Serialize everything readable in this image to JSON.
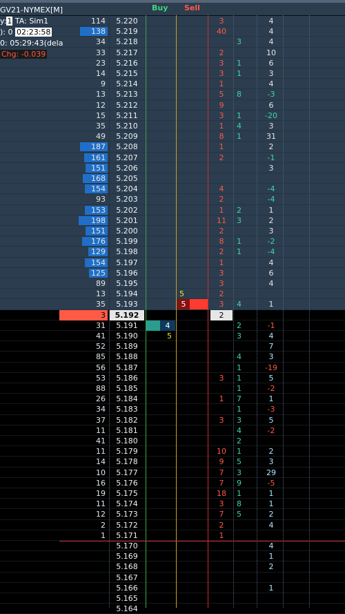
{
  "header": {
    "buy": "Buy",
    "sell": "Sell"
  },
  "instrument": {
    "symbol": "GV21-NYMEX[M]",
    "qty_label": "y:",
    "qty": "1",
    "ta": "TA: Sim1",
    "pos": "0",
    "pos_prefix": "):",
    "timer": "02:23:58",
    "clock": "0: 05:29:43(dela",
    "chg": "Chg: -0.039"
  },
  "colors": {
    "ask_bg": "#2b3d4f",
    "bid_bg": "#000000",
    "bar": "#1f6fc8",
    "buy_line": "#3aa845",
    "sell_line": "#d4a020",
    "red_line": "#c83030",
    "text_red": "#ff5a45",
    "text_green": "#3fd6a9",
    "text_yellow": "#f5e03a"
  },
  "rows": [
    {
      "p": "5.220",
      "v": "114",
      "b": 0,
      "c1": "3",
      "c2": "",
      "c3": "4"
    },
    {
      "p": "5.219",
      "v": "138",
      "b": 1.0,
      "c1": "40",
      "c2": "",
      "c3": "4"
    },
    {
      "p": "5.218",
      "v": "34",
      "b": 0,
      "c1": "",
      "c2": "3",
      "c3": "4"
    },
    {
      "p": "5.217",
      "v": "33",
      "b": 0,
      "c1": "2",
      "c2": "",
      "c3": "10"
    },
    {
      "p": "5.216",
      "v": "23",
      "b": 0,
      "c1": "3",
      "c2": "1",
      "c3": "6"
    },
    {
      "p": "5.215",
      "v": "14",
      "b": 0,
      "c1": "3",
      "c2": "1",
      "c3": "3"
    },
    {
      "p": "5.214",
      "v": "9",
      "b": 0,
      "c1": "1",
      "c2": "",
      "c3": "4"
    },
    {
      "p": "5.213",
      "v": "13",
      "b": 0,
      "c1": "5",
      "c2": "8",
      "c3": "-3"
    },
    {
      "p": "5.212",
      "v": "12",
      "b": 0,
      "c1": "9",
      "c2": "",
      "c3": "6"
    },
    {
      "p": "5.211",
      "v": "15",
      "b": 0,
      "c1": "3",
      "c2": "1",
      "c3": "-20"
    },
    {
      "p": "5.210",
      "v": "35",
      "b": 0,
      "c1": "1",
      "c2": "4",
      "c3": "3"
    },
    {
      "p": "5.209",
      "v": "49",
      "b": 0,
      "c1": "8",
      "c2": "1",
      "c3": "31"
    },
    {
      "p": "5.208",
      "v": "187",
      "b": 1.0,
      "c1": "1",
      "c2": "",
      "c3": "2"
    },
    {
      "p": "5.207",
      "v": "161",
      "b": 0.85,
      "c1": "2",
      "c2": "",
      "c3": "-1"
    },
    {
      "p": "5.206",
      "v": "151",
      "b": 0.8,
      "c1": "",
      "c2": "",
      "c3": "3"
    },
    {
      "p": "5.205",
      "v": "168",
      "b": 0.9,
      "c1": "",
      "c2": "",
      "c3": ""
    },
    {
      "p": "5.204",
      "v": "154",
      "b": 0.82,
      "c1": "4",
      "c2": "",
      "c3": "-4"
    },
    {
      "p": "5.203",
      "v": "93",
      "b": 0,
      "c1": "2",
      "c2": "",
      "c3": "-4"
    },
    {
      "p": "5.202",
      "v": "153",
      "b": 0.82,
      "c1": "1",
      "c2": "2",
      "c3": "1"
    },
    {
      "p": "5.201",
      "v": "198",
      "b": 1.05,
      "c1": "11",
      "c2": "3",
      "c3": "2"
    },
    {
      "p": "5.200",
      "v": "151",
      "b": 0.8,
      "c1": "2",
      "c2": "",
      "c3": "3"
    },
    {
      "p": "5.199",
      "v": "176",
      "b": 0.93,
      "c1": "8",
      "c2": "1",
      "c3": "-2"
    },
    {
      "p": "5.198",
      "v": "129",
      "b": 0.7,
      "c1": "2",
      "c2": "1",
      "c3": "-4"
    },
    {
      "p": "5.197",
      "v": "154",
      "b": 0.82,
      "c1": "1",
      "c2": "",
      "c3": "4"
    },
    {
      "p": "5.196",
      "v": "125",
      "b": 0.67,
      "c1": "3",
      "c2": "",
      "c3": "6"
    },
    {
      "p": "5.195",
      "v": "89",
      "b": 0,
      "c1": "3",
      "c2": "",
      "c3": "4"
    },
    {
      "p": "5.194",
      "v": "13",
      "b": 0,
      "c1": "2",
      "c2": "",
      "c3": "",
      "sellq": "5"
    },
    {
      "p": "5.193",
      "v": "35",
      "b": 0,
      "c1": "3",
      "c2": "4",
      "c3": "1",
      "sellbox": "5"
    },
    {
      "p": "5.192",
      "v": "3",
      "b": 0,
      "c1": "2",
      "c2": "",
      "c3": "",
      "last": true
    },
    {
      "p": "5.191",
      "v": "31",
      "b": 0,
      "c1": "",
      "c2": "2",
      "c3": "-1",
      "buybox": "4"
    },
    {
      "p": "5.190",
      "v": "41",
      "b": 0,
      "c1": "",
      "c2": "3",
      "c3": "4",
      "buyq": "5"
    },
    {
      "p": "5.189",
      "v": "52",
      "b": 0,
      "c1": "",
      "c2": "",
      "c3": "7"
    },
    {
      "p": "5.188",
      "v": "85",
      "b": 0,
      "c1": "",
      "c2": "4",
      "c3": "3"
    },
    {
      "p": "5.187",
      "v": "56",
      "b": 0,
      "c1": "",
      "c2": "1",
      "c3": "-19"
    },
    {
      "p": "5.186",
      "v": "53",
      "b": 0,
      "c1": "3",
      "c2": "1",
      "c3": "5"
    },
    {
      "p": "5.185",
      "v": "88",
      "b": 0,
      "c1": "",
      "c2": "1",
      "c3": "-2"
    },
    {
      "p": "5.184",
      "v": "26",
      "b": 0,
      "c1": "1",
      "c2": "7",
      "c3": "1"
    },
    {
      "p": "5.183",
      "v": "34",
      "b": 0,
      "c1": "",
      "c2": "1",
      "c3": "-3"
    },
    {
      "p": "5.182",
      "v": "37",
      "b": 0,
      "c1": "3",
      "c2": "3",
      "c3": "5"
    },
    {
      "p": "5.181",
      "v": "11",
      "b": 0,
      "c1": "",
      "c2": "4",
      "c3": "-2"
    },
    {
      "p": "5.180",
      "v": "41",
      "b": 0,
      "c1": "",
      "c2": "2",
      "c3": ""
    },
    {
      "p": "5.179",
      "v": "11",
      "b": 0,
      "c1": "10",
      "c2": "1",
      "c3": "2"
    },
    {
      "p": "5.178",
      "v": "14",
      "b": 0,
      "c1": "9",
      "c2": "5",
      "c3": "3"
    },
    {
      "p": "5.177",
      "v": "10",
      "b": 0,
      "c1": "7",
      "c2": "3",
      "c3": "29"
    },
    {
      "p": "5.176",
      "v": "16",
      "b": 0,
      "c1": "7",
      "c2": "9",
      "c3": "-5"
    },
    {
      "p": "5.175",
      "v": "19",
      "b": 0,
      "c1": "18",
      "c2": "1",
      "c3": "1"
    },
    {
      "p": "5.174",
      "v": "11",
      "b": 0,
      "c1": "3",
      "c2": "8",
      "c3": "1"
    },
    {
      "p": "5.173",
      "v": "12",
      "b": 0,
      "c1": "7",
      "c2": "5",
      "c3": "2"
    },
    {
      "p": "5.172",
      "v": "2",
      "b": 0,
      "c1": "2",
      "c2": "",
      "c3": "4"
    },
    {
      "p": "5.171",
      "v": "1",
      "b": 0,
      "c1": "1",
      "c2": "",
      "c3": ""
    },
    {
      "p": "5.170",
      "v": "",
      "b": 0,
      "c1": "",
      "c2": "",
      "c3": "4"
    },
    {
      "p": "5.169",
      "v": "",
      "b": 0,
      "c1": "",
      "c2": "",
      "c3": "1"
    },
    {
      "p": "5.168",
      "v": "",
      "b": 0,
      "c1": "",
      "c2": "",
      "c3": "2"
    },
    {
      "p": "5.167",
      "v": "",
      "b": 0,
      "c1": "",
      "c2": "",
      "c3": ""
    },
    {
      "p": "5.166",
      "v": "",
      "b": 0,
      "c1": "",
      "c2": "",
      "c3": "1"
    },
    {
      "p": "5.165",
      "v": "",
      "b": 0,
      "c1": "",
      "c2": "",
      "c3": ""
    },
    {
      "p": "5.164",
      "v": "",
      "b": 0,
      "c1": "",
      "c2": "",
      "c3": ""
    }
  ]
}
